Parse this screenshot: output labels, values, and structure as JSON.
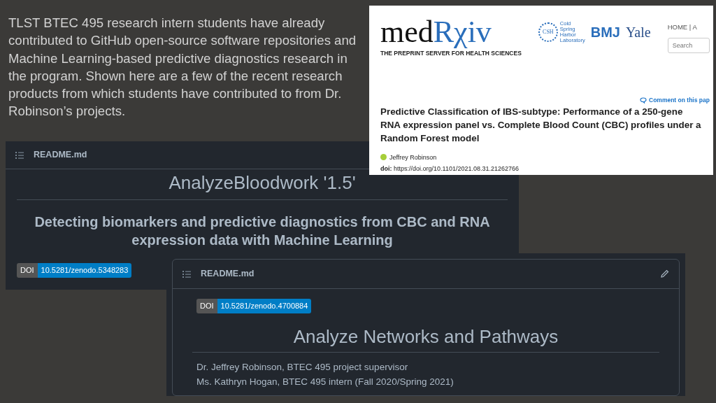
{
  "slide_text": "TLST BTEC 495 research intern students have already contributed to GitHub open-source software repositories and Machine Learning-based predictive diagnostics research in the program.  Shown here are a few of the recent research products from which students have contributed to from Dr. Robinson’s projects.",
  "readme_panels": [
    {
      "header": "README.md",
      "blocks": [
        {
          "kind": "heading",
          "text": "AnalyzeBloodwork '1.5'"
        },
        {
          "kind": "subheading",
          "text": "Detecting biomarkers and predictive diagnostics from CBC and RNA expression data with Machine Learning"
        },
        {
          "kind": "doi",
          "label": "DOI",
          "value": "10.5281/zenodo.5348283"
        }
      ]
    },
    {
      "header": "README.md",
      "edit_button": true,
      "blocks": [
        {
          "kind": "doi",
          "label": "DOI",
          "value": "10.5281/zenodo.4700884"
        },
        {
          "kind": "heading",
          "text": "Analyze Networks and Pathways"
        },
        {
          "kind": "text",
          "text": "Dr. Jeffrey Robinson, BTEC 495 project supervisor"
        },
        {
          "kind": "text",
          "text": "Ms. Kathryn Hogan, BTEC 495 intern (Fall 2020/Spring 2021)"
        }
      ]
    }
  ],
  "preprint_page": {
    "logo_first": "med",
    "logo_second": "Rχiv",
    "tagline": "THE PREPRINT SERVER FOR HEALTH SCIENCES",
    "partners": {
      "csh_mark": "CSH",
      "csh_name": [
        "Cold",
        "Spring",
        "Harbor",
        "Laboratory"
      ],
      "bmj": "BMJ",
      "yale": "Yale"
    },
    "nav": "HOME | A",
    "search": {
      "placeholder": "Search"
    },
    "comment_link": "Comment on this pap",
    "title": "Predictive Classification of IBS-subtype: Performance of a 250-gene RNA expression panel vs. Complete Blood Count (CBC) profiles under a Random Forest model",
    "author": "Jeffrey Robinson",
    "doi": "**doi:** https://doi.org/10.1101/2021.08.31.21262766"
  }
}
